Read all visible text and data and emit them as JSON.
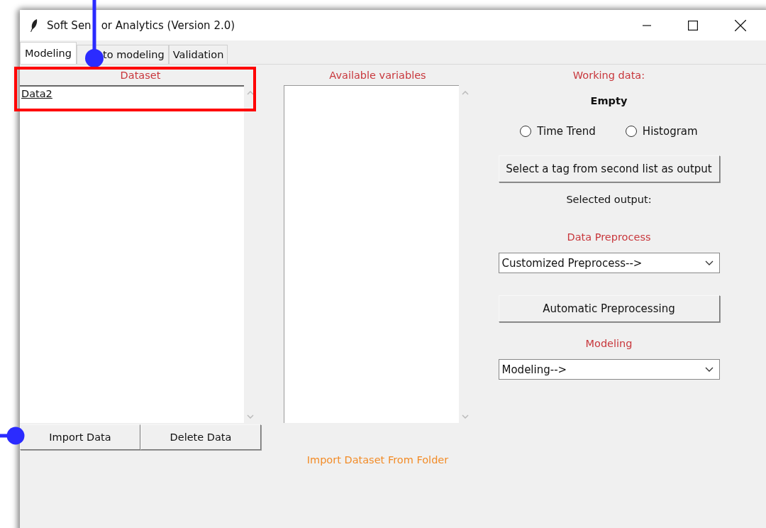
{
  "window": {
    "title_parts": [
      "Soft Sen",
      "or Analytics (Version 2.0)"
    ]
  },
  "tabs": [
    {
      "label": "Modeling",
      "selected": true
    },
    {
      "label": "to modeling",
      "selected": false
    },
    {
      "label": "Validation",
      "selected": false
    }
  ],
  "dataset": {
    "heading": "Dataset",
    "items": [
      {
        "label": "Data2",
        "selected": false
      }
    ],
    "buttons": [
      "Import Data",
      "Delete Data"
    ]
  },
  "variables": {
    "heading": "Available variables",
    "note": "Import Dataset From Folder"
  },
  "working": {
    "heading": "Working data:",
    "value": "Empty",
    "radios": [
      {
        "label": "Time Trend",
        "checked": false
      },
      {
        "label": "Histogram",
        "checked": false
      }
    ],
    "select_button": "Select a tag from second list as output",
    "selected_output": "Selected output:",
    "preprocess_heading": "Data Preprocess",
    "preprocess_select": "Customized Preprocess-->",
    "auto_button": "Automatic Preprocessing",
    "modeling_heading": "Modeling",
    "modeling_select": "Modeling-->"
  }
}
